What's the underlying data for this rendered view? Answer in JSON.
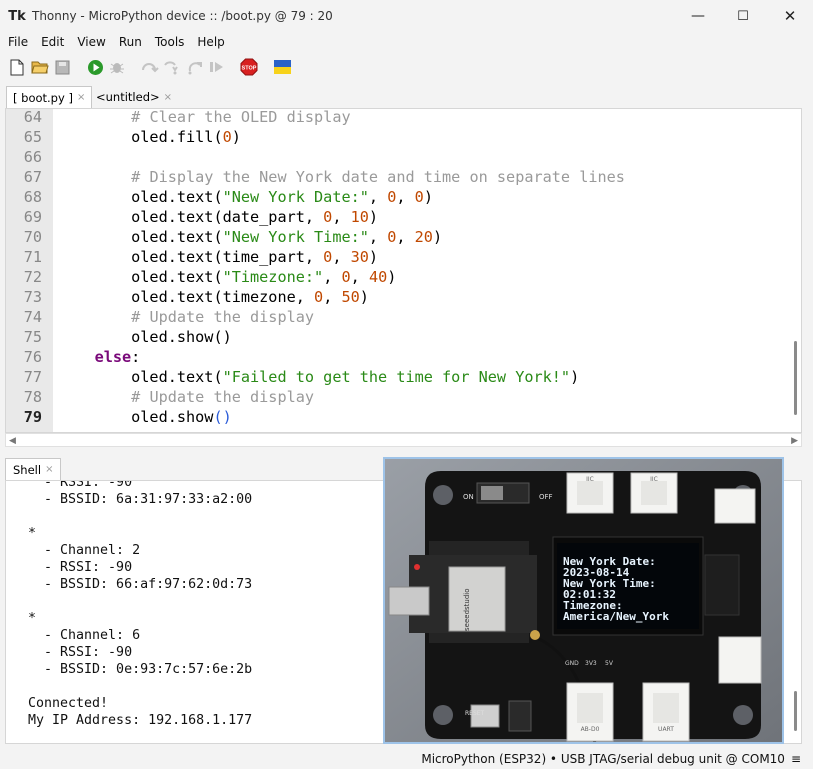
{
  "window": {
    "title": "Thonny  -  MicroPython device :: /boot.py  @  79 : 20",
    "app_icon": "Tk"
  },
  "menu": [
    "File",
    "Edit",
    "View",
    "Run",
    "Tools",
    "Help"
  ],
  "toolbar": {
    "icons": [
      "new-file",
      "open-file",
      "save",
      "run",
      "debug",
      "step-over",
      "step-into",
      "step-out",
      "resume",
      "stop",
      "ukraine-flag"
    ],
    "stop_label": "STOP"
  },
  "tabs": [
    {
      "label": "[ boot.py ]",
      "close": "×"
    },
    {
      "label": "<untitled>",
      "close": "×"
    }
  ],
  "editor": {
    "lines": [
      {
        "n": "64",
        "tokens": [
          {
            "t": "        "
          },
          {
            "t": "# Clear the OLED display",
            "c": "comment"
          }
        ]
      },
      {
        "n": "65",
        "tokens": [
          {
            "t": "        oled.fill("
          },
          {
            "t": "0",
            "c": "num"
          },
          {
            "t": ")"
          }
        ]
      },
      {
        "n": "66",
        "tokens": []
      },
      {
        "n": "67",
        "tokens": [
          {
            "t": "        "
          },
          {
            "t": "# Display the New York date and time on separate lines",
            "c": "comment"
          }
        ]
      },
      {
        "n": "68",
        "tokens": [
          {
            "t": "        oled.text("
          },
          {
            "t": "\"New York Date:\"",
            "c": "str"
          },
          {
            "t": ", "
          },
          {
            "t": "0",
            "c": "num"
          },
          {
            "t": ", "
          },
          {
            "t": "0",
            "c": "num"
          },
          {
            "t": ")"
          }
        ]
      },
      {
        "n": "69",
        "tokens": [
          {
            "t": "        oled.text(date_part, "
          },
          {
            "t": "0",
            "c": "num"
          },
          {
            "t": ", "
          },
          {
            "t": "10",
            "c": "num"
          },
          {
            "t": ")"
          }
        ]
      },
      {
        "n": "70",
        "tokens": [
          {
            "t": "        oled.text("
          },
          {
            "t": "\"New York Time:\"",
            "c": "str"
          },
          {
            "t": ", "
          },
          {
            "t": "0",
            "c": "num"
          },
          {
            "t": ", "
          },
          {
            "t": "20",
            "c": "num"
          },
          {
            "t": ")"
          }
        ]
      },
      {
        "n": "71",
        "tokens": [
          {
            "t": "        oled.text(time_part, "
          },
          {
            "t": "0",
            "c": "num"
          },
          {
            "t": ", "
          },
          {
            "t": "30",
            "c": "num"
          },
          {
            "t": ")"
          }
        ]
      },
      {
        "n": "72",
        "tokens": [
          {
            "t": "        oled.text("
          },
          {
            "t": "\"Timezone:\"",
            "c": "str"
          },
          {
            "t": ", "
          },
          {
            "t": "0",
            "c": "num"
          },
          {
            "t": ", "
          },
          {
            "t": "40",
            "c": "num"
          },
          {
            "t": ")"
          }
        ]
      },
      {
        "n": "73",
        "tokens": [
          {
            "t": "        oled.text(timezone, "
          },
          {
            "t": "0",
            "c": "num"
          },
          {
            "t": ", "
          },
          {
            "t": "50",
            "c": "num"
          },
          {
            "t": ")"
          }
        ]
      },
      {
        "n": "74",
        "tokens": [
          {
            "t": "        "
          },
          {
            "t": "# Update the display",
            "c": "comment"
          }
        ]
      },
      {
        "n": "75",
        "tokens": [
          {
            "t": "        oled.show()"
          }
        ]
      },
      {
        "n": "76",
        "tokens": [
          {
            "t": "    "
          },
          {
            "t": "else",
            "c": "kw"
          },
          {
            "t": ":"
          }
        ]
      },
      {
        "n": "77",
        "tokens": [
          {
            "t": "        oled.text("
          },
          {
            "t": "\"Failed to get the time for New York!\"",
            "c": "str"
          },
          {
            "t": ")"
          }
        ]
      },
      {
        "n": "78",
        "tokens": [
          {
            "t": "        "
          },
          {
            "t": "# Update the display",
            "c": "comment"
          }
        ]
      },
      {
        "n": "79",
        "tokens": [
          {
            "t": "        oled.show"
          },
          {
            "t": "()",
            "c": "paren"
          }
        ],
        "current": true
      }
    ]
  },
  "shell": {
    "tab_label": "Shell",
    "tab_close": "×",
    "lines": [
      "  - RSSI: -90",
      "  - BSSID: 6a:31:97:33:a2:00",
      "",
      "*",
      "  - Channel: 2",
      "  - RSSI: -90",
      "  - BSSID: 66:af:97:62:0d:73",
      "",
      "*",
      "  - Channel: 6",
      "  - RSSI: -90",
      "  - BSSID: 0e:93:7c:57:6e:2b",
      "",
      "Connected!",
      "My IP Address: 192.168.1.177"
    ]
  },
  "photo": {
    "board_brand": "seeedstudio",
    "connector_labels": [
      "IIC",
      "IIC",
      "UART",
      "AB-D0",
      "ON",
      "OFF",
      "RESET",
      "GND",
      "3V3",
      "5V"
    ],
    "oled_lines": [
      "New York Date:",
      "2023-08-14",
      "New York Time:",
      "02:01:32",
      "Timezone:",
      "America/New_York"
    ]
  },
  "status": {
    "text": "MicroPython (ESP32)  •  USB JTAG/serial debug unit @ COM10",
    "menu_glyph": "≡"
  },
  "colors": {
    "comment": "#9a9a9a",
    "number": "#c04800",
    "string": "#2a8a17",
    "keyword": "#7a0a7a",
    "oled_text": "#e8f4ff"
  }
}
